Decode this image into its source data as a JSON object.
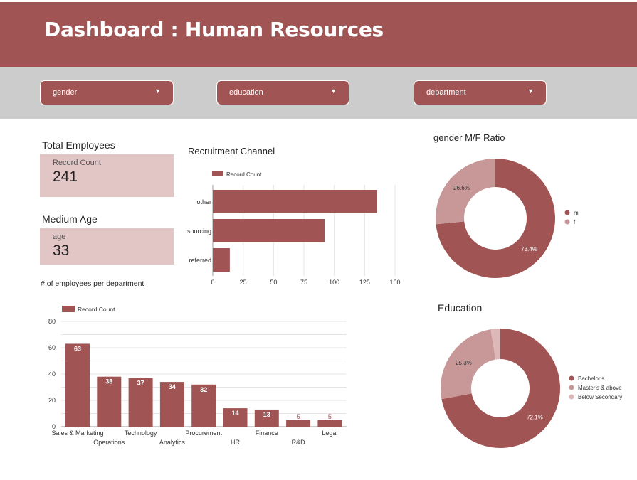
{
  "header": {
    "title": "Dashboard : Human Resources"
  },
  "filters": [
    {
      "label": "gender",
      "icon": "dropdown-arrow"
    },
    {
      "label": "education",
      "icon": "dropdown-arrow"
    },
    {
      "label": "department",
      "icon": "dropdown-arrow"
    }
  ],
  "colors": {
    "primary": "#a05454",
    "light": "#c89898",
    "lighter": "#deb8b8",
    "scorecard_bg": "#e2c5c5",
    "filter_bg": "#cccccc"
  },
  "total_employees": {
    "title": "Total Employees",
    "label": "Record Count",
    "value": "241"
  },
  "medium_age": {
    "title": "Medium Age",
    "label": "age",
    "value": "33"
  },
  "recruitment": {
    "title": "Recruitment Channel"
  },
  "department_chart": {
    "title": "# of employees per department"
  },
  "gender_chart": {
    "title": "gender M/F Ratio"
  },
  "education_chart": {
    "title": "Education"
  },
  "chart_data": [
    {
      "type": "bar",
      "orientation": "horizontal",
      "title": "Recruitment Channel",
      "categories": [
        "other",
        "sourcing",
        "referred"
      ],
      "series": [
        {
          "name": "Record Count",
          "values": [
            135,
            92,
            14
          ]
        }
      ],
      "xlim": [
        0,
        150
      ],
      "x_ticks": [
        "0",
        "25",
        "50",
        "75",
        "100",
        "125",
        "150"
      ],
      "legend": "top-left",
      "grid": true
    },
    {
      "type": "bar",
      "title": "# of employees per department",
      "categories": [
        "Sales & Marketing",
        "Operations",
        "Technology",
        "Analytics",
        "Procurement",
        "HR",
        "Finance",
        "R&D",
        "Legal"
      ],
      "series": [
        {
          "name": "Record Count",
          "values": [
            63,
            38,
            37,
            34,
            32,
            14,
            13,
            5,
            5
          ]
        }
      ],
      "ylim": [
        0,
        80
      ],
      "y_ticks": [
        "0",
        "20",
        "40",
        "60",
        "80"
      ],
      "legend": "top-left",
      "grid": true
    },
    {
      "type": "pie",
      "donut": true,
      "title": "gender M/F Ratio",
      "labels": [
        "m",
        "f"
      ],
      "values": [
        73.4,
        26.6
      ],
      "value_labels": [
        "73.4%",
        "26.6%"
      ],
      "legend": "right"
    },
    {
      "type": "pie",
      "donut": true,
      "title": "Education",
      "labels": [
        "Bachelor's",
        "Master's & above",
        "Below Secondary"
      ],
      "values": [
        72.1,
        25.3,
        2.6
      ],
      "value_labels": [
        "72.1%",
        "25.3%",
        ""
      ],
      "legend": "right"
    }
  ]
}
